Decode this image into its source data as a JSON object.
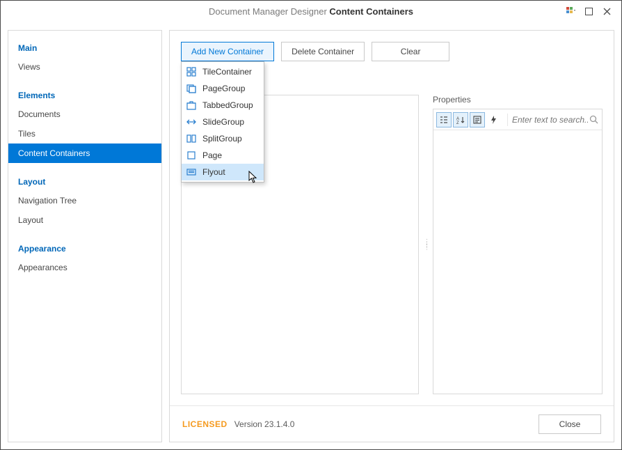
{
  "titlebar": {
    "prefix": "Document Manager Designer",
    "title": "Content Containers"
  },
  "sidebar": {
    "groups": [
      {
        "header": "Main",
        "items": [
          "Views"
        ]
      },
      {
        "header": "Elements",
        "items": [
          "Documents",
          "Tiles",
          "Content Containers"
        ]
      },
      {
        "header": "Layout",
        "items": [
          "Navigation Tree",
          "Layout"
        ]
      },
      {
        "header": "Appearance",
        "items": [
          "Appearances"
        ]
      }
    ],
    "selected": "Content Containers"
  },
  "toolbar": {
    "addNew": "Add New Container",
    "delete": "Delete Container",
    "clear": "Clear"
  },
  "menu": {
    "items": [
      "TileContainer",
      "PageGroup",
      "TabbedGroup",
      "SlideGroup",
      "SplitGroup",
      "Page",
      "Flyout"
    ],
    "hovered": "Flyout"
  },
  "properties": {
    "label": "Properties",
    "searchPlaceholder": "Enter text to search..."
  },
  "footer": {
    "licensed": "LICENSED",
    "version": "Version 23.1.4.0",
    "close": "Close"
  }
}
